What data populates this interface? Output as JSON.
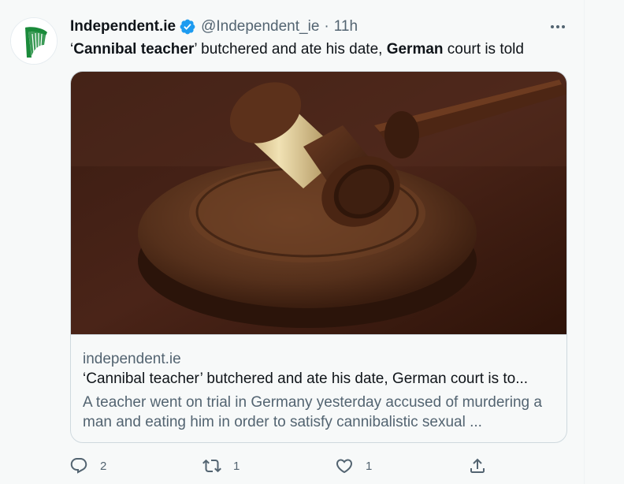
{
  "tweet": {
    "display_name": "Independent.ie",
    "handle": "@Independent_ie",
    "separator": "·",
    "time": "11h",
    "text_parts": {
      "open_quote": "‘",
      "bold1": "Cannibal teacher",
      "mid1": "’ butchered and ate his date, ",
      "bold2": "German",
      "end": " court is told"
    }
  },
  "card": {
    "domain": "independent.ie",
    "title": "‘Cannibal teacher’ butchered and ate his date, German court is to...",
    "description": "A teacher went on trial in Germany yesterday accused of murdering a man and eating him in order to satisfy cannibalistic sexual ..."
  },
  "actions": {
    "reply_count": "2",
    "retweet_count": "1",
    "like_count": "1"
  },
  "icons": {
    "avatar": "harp-logo-icon",
    "verified": "verified-badge-icon",
    "more": "more-icon",
    "reply": "reply-icon",
    "retweet": "retweet-icon",
    "like": "heart-icon",
    "share": "share-icon"
  },
  "colors": {
    "verified_blue": "#1d9bf0",
    "harp_green": "#1a8a3a",
    "secondary_text": "#536471",
    "primary_text": "#0f1419"
  }
}
